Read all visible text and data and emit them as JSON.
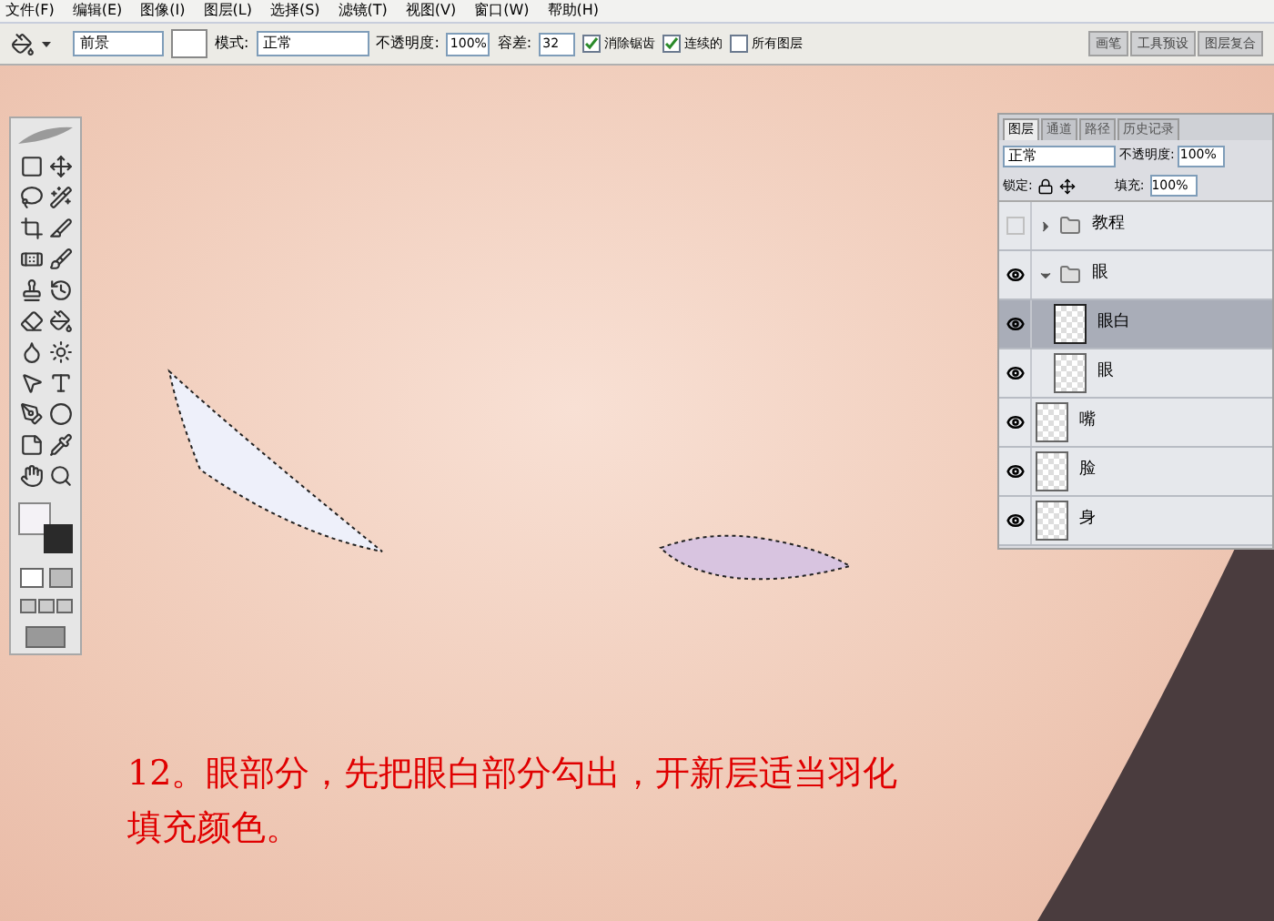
{
  "menu_bar": [
    "文件(F)",
    "编辑(E)",
    "图像(I)",
    "图层(L)",
    "选择(S)",
    "滤镜(T)",
    "视图(V)",
    "窗口(W)",
    "帮助(H)"
  ],
  "options_bar": {
    "fill_source": "前景",
    "mode_label": "模式:",
    "mode": "正常",
    "opacity_label": "不透明度:",
    "opacity": "100%",
    "tolerance_label": "容差:",
    "tolerance": "32",
    "checkboxes": [
      {
        "label": "消除锯齿",
        "checked": true
      },
      {
        "label": "连续的",
        "checked": true
      },
      {
        "label": "所有图层",
        "checked": false
      }
    ],
    "palette_tabs": [
      "画笔",
      "工具预设",
      "图层复合"
    ]
  },
  "layers_panel": {
    "tabs": [
      {
        "label": "图层",
        "selected": true
      },
      {
        "label": "通道",
        "selected": false
      },
      {
        "label": "路径",
        "selected": false
      },
      {
        "label": "历史记录",
        "selected": false
      }
    ],
    "blend_mode": "正常",
    "opacity_label": "不透明度:",
    "opacity": "100%",
    "lock_label": "锁定:",
    "fill_label": "填充:",
    "fill": "100%",
    "layers": [
      {
        "kind": "group",
        "name": "教程",
        "visible": false,
        "expanded": false,
        "selected": false
      },
      {
        "kind": "group",
        "name": "眼",
        "visible": true,
        "expanded": true,
        "selected": false,
        "children": [
          {
            "kind": "layer",
            "name": "眼白",
            "visible": true,
            "selected": true
          },
          {
            "kind": "layer",
            "name": "眼",
            "visible": true,
            "selected": false
          }
        ]
      },
      {
        "kind": "layer",
        "name": "嘴",
        "visible": true,
        "selected": false
      },
      {
        "kind": "layer",
        "name": "脸",
        "visible": true,
        "selected": false
      },
      {
        "kind": "layer",
        "name": "身",
        "visible": true,
        "selected": false
      }
    ]
  },
  "caption": [
    "12。眼部分，先把眼白部分勾出，开新层适当羽化",
    "填充颜色。"
  ]
}
